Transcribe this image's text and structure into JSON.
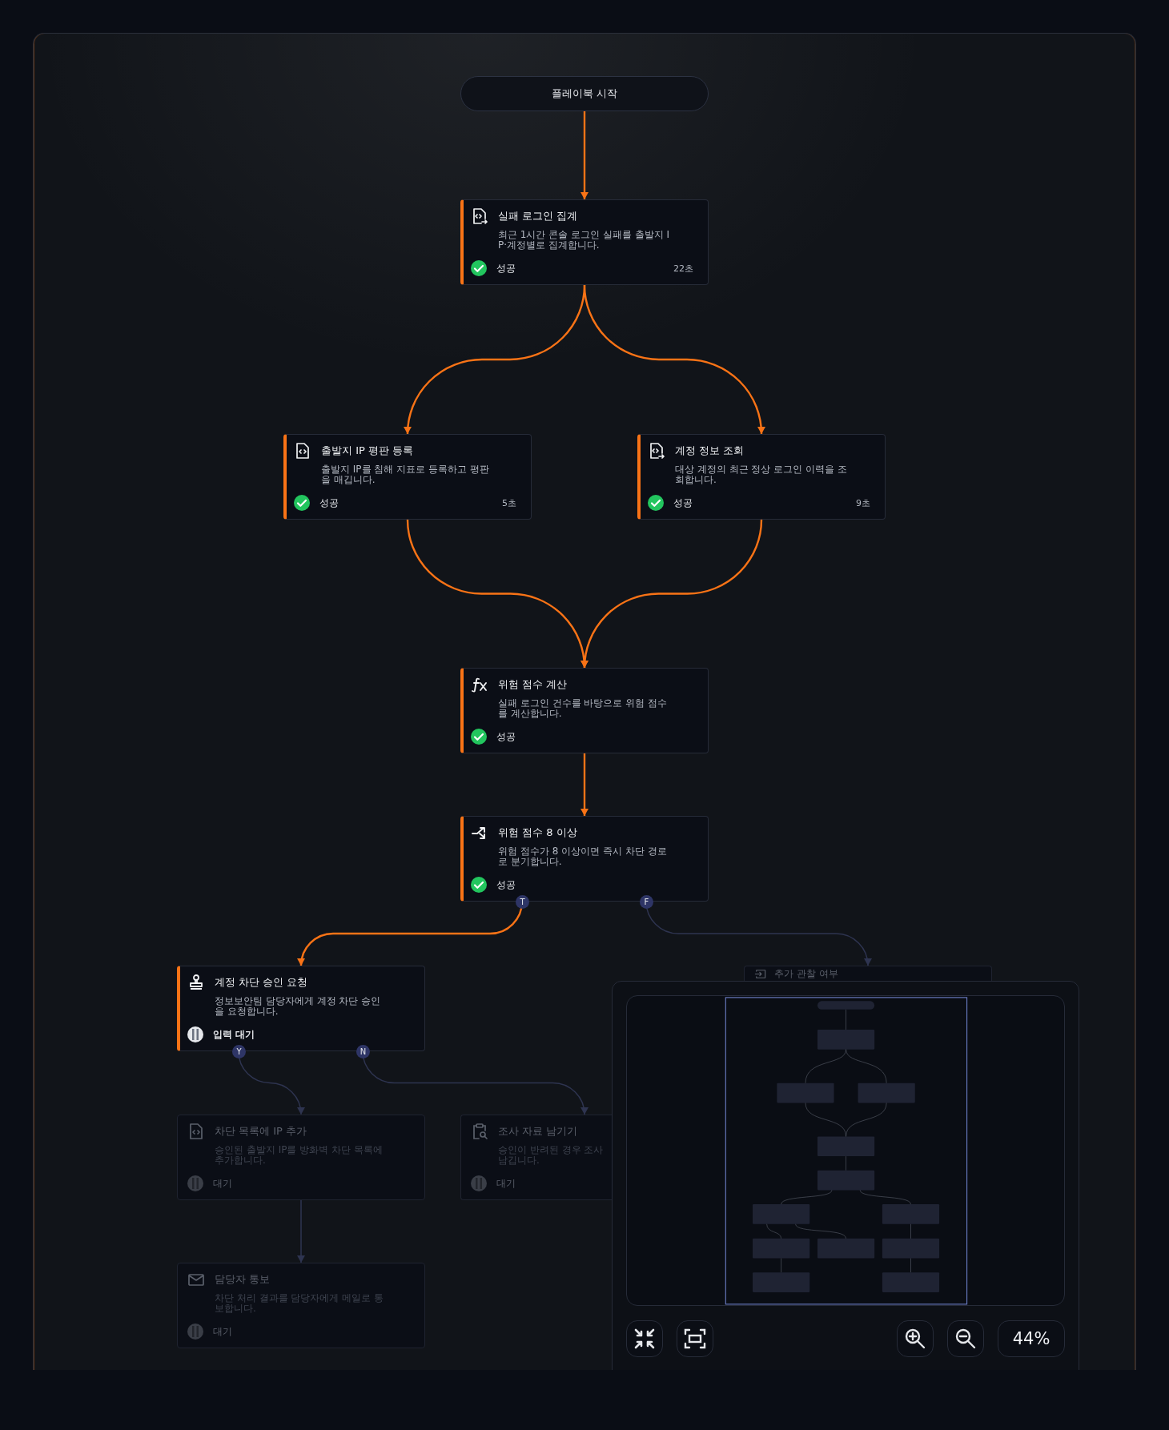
{
  "nodes": [
    {
      "kind": "start",
      "title": "플레이북 시작"
    },
    {
      "kind": "script_output",
      "title": "실패 로그인 집계",
      "desc_lines": [
        "최근 1시간 콘솔 로그인 실패를 출발지 I",
        "P·계정별로 집계합니다."
      ],
      "status": {
        "kind": "success",
        "text": "성공",
        "duration": "22초"
      }
    },
    {
      "kind": "script",
      "title": "출발지 IP 평판 등록",
      "desc_lines": [
        "출발지 IP를 침해 지표로 등록하고 평판",
        "을 매깁니다."
      ],
      "status": {
        "kind": "success",
        "text": "성공",
        "duration": "5초"
      }
    },
    {
      "kind": "script_output",
      "title": "계정 정보 조회",
      "desc_lines": [
        "대상 계정의 최근 정상 로그인 이력을 조",
        "회합니다."
      ],
      "status": {
        "kind": "success",
        "text": "성공",
        "duration": "9초"
      }
    },
    {
      "kind": "formula",
      "title": "위험 점수 계산",
      "desc_lines": [
        "실패 로그인 건수를 바탕으로 위험 점수",
        "를 계산합니다."
      ],
      "status": {
        "kind": "success",
        "text": "성공"
      }
    },
    {
      "kind": "condition",
      "title": "위험 점수 8 이상",
      "desc_lines": [
        "위험 점수가 8 이상이면 즉시 차단 경로",
        "로 분기합니다."
      ],
      "status": {
        "kind": "success",
        "text": "성공"
      }
    },
    {
      "kind": "approval",
      "title": "계정 차단 승인 요청",
      "desc_lines": [
        "정보보안팀 담당자에게 계정 차단 승인",
        "을 요청합니다."
      ],
      "status": {
        "kind": "input",
        "text": "입력 대기"
      }
    },
    {
      "kind": "script",
      "title": "차단 목록에 IP 추가",
      "desc_lines": [
        "승인된 출발지 IP를 방화벽 차단 목록에",
        "추가합니다."
      ],
      "status": {
        "kind": "pending",
        "text": "대기"
      }
    },
    {
      "kind": "evidence",
      "title": "조사 자료 남기기",
      "desc_lines": [
        "승인이 반려된 경우 조사",
        "남깁니다."
      ],
      "status": {
        "kind": "pending",
        "text": "대기"
      }
    },
    {
      "kind": "notify",
      "title": "담당자 통보",
      "desc_lines": [
        "차단 처리 결과를 담당자에게 메일로 통",
        "보합니다."
      ],
      "status": {
        "kind": "pending",
        "text": "대기"
      }
    },
    {
      "kind": "transfer",
      "title": "추가 관찰 여부"
    }
  ],
  "edges": [
    {
      "active": true
    },
    {
      "active": true
    },
    {
      "active": true
    },
    {
      "active": true
    },
    {
      "active": true
    },
    {
      "active": true
    },
    {
      "active": true,
      "port": "T"
    },
    {
      "active": false,
      "port": "F"
    },
    {
      "active": false,
      "port": "Y"
    },
    {
      "active": false,
      "port": "N"
    },
    {
      "active": false
    }
  ],
  "minimap": {
    "zoom": "44%"
  }
}
